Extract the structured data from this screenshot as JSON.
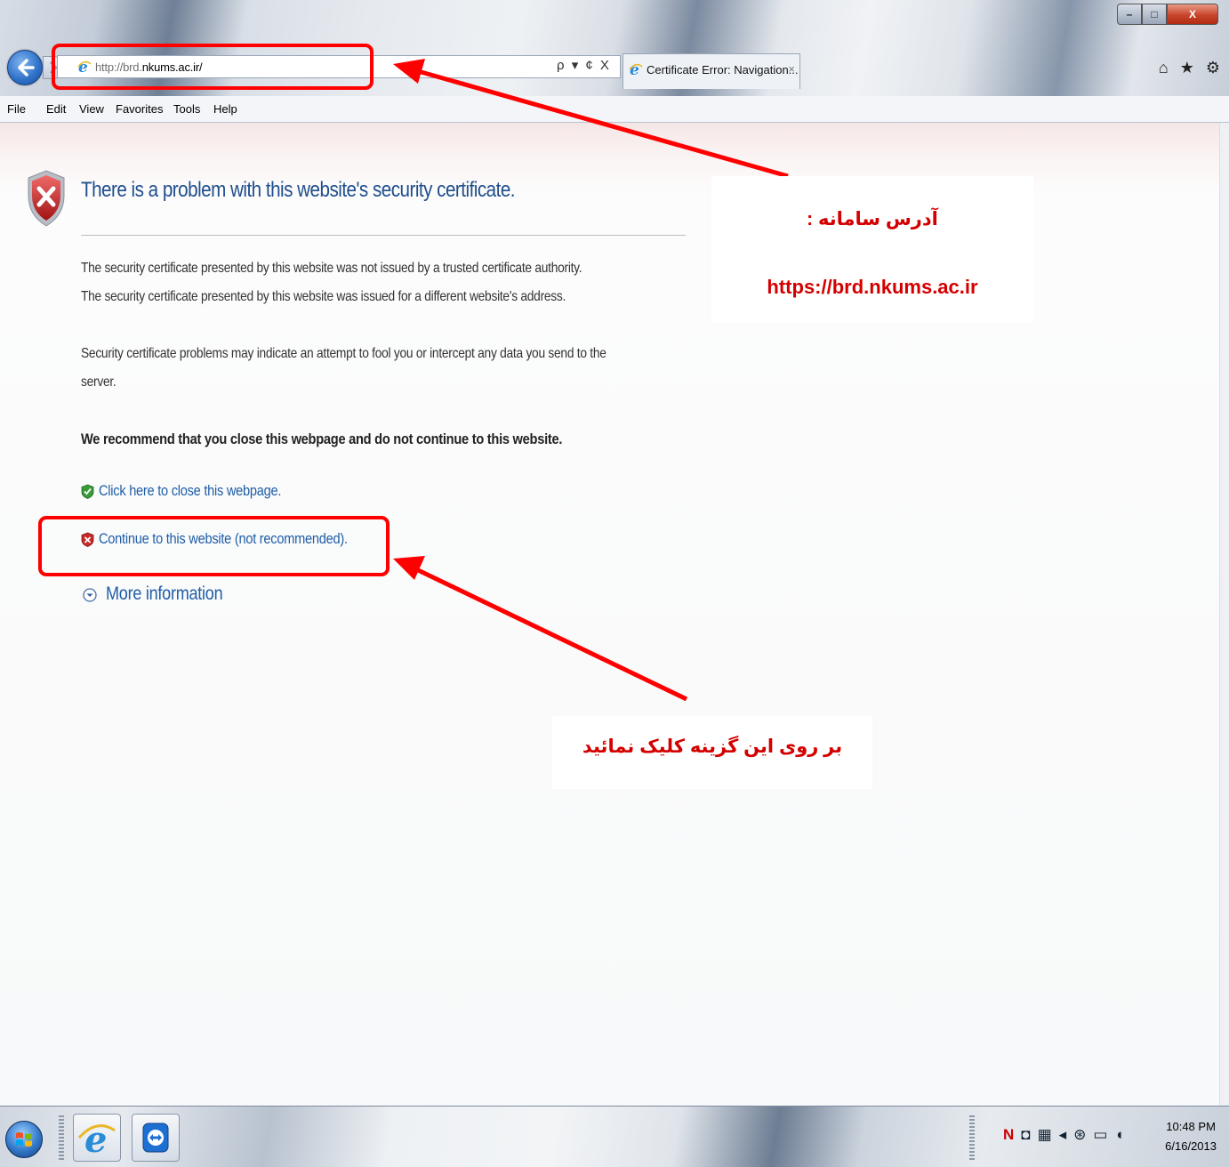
{
  "browser": {
    "address_url_prefix": "http://brd.",
    "address_url_domain": "nkums.ac.ir/",
    "address_controls": "ρ ▾ ¢ X",
    "tab_title": "Certificate Error: Navigation...",
    "tab_close": "×",
    "window_controls": {
      "minimize": "–",
      "maximize": "□",
      "close": "X"
    },
    "toolbar_icons": "⌂ ★ ⚙"
  },
  "menu": [
    "File",
    "Edit",
    "View",
    "Favorites",
    "Tools",
    "Help"
  ],
  "page": {
    "heading": "There is a problem with this website's security certificate.",
    "para1_line1": "The security certificate presented by this website was not issued by a trusted certificate authority.",
    "para1_line2": "The security certificate presented by this website was issued for a different website's address.",
    "para2_line1": "Security certificate problems may indicate an attempt to fool you or intercept any data you send to the",
    "para2_line2": "server.",
    "recommendation": "We recommend that you close this webpage and do not continue to this website.",
    "close_link": "Click here to close this webpage.",
    "continue_link": "Continue to this website (not recommended).",
    "more_info": "More information"
  },
  "annotations": {
    "address_label": "آدرس سامانه :",
    "address_url": "https://brd.nkums.ac.ir",
    "click_label": "بر روی این گزینه کلیک نمائید",
    "color": "#ff0000"
  },
  "taskbar": {
    "time": "10:48 PM",
    "date": "6/16/2013",
    "tray_n": "N"
  }
}
